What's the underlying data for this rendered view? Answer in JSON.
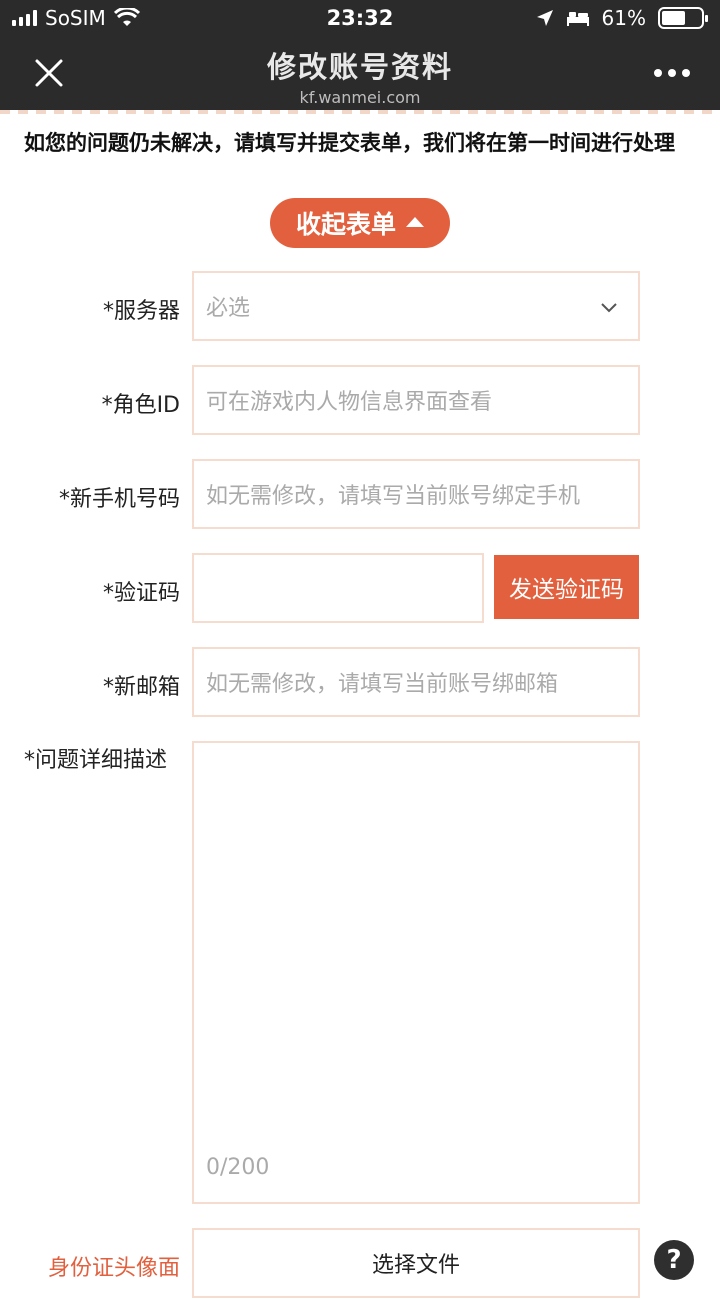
{
  "status_bar": {
    "carrier": "SoSIM",
    "time": "23:32",
    "battery_percent": "61%",
    "battery_level": 0.61
  },
  "nav": {
    "title": "修改账号资料",
    "subtitle": "kf.wanmei.com",
    "close_icon": "close-icon",
    "more_icon": "more-icon"
  },
  "notice": "如您的问题仍未解决，请填写并提交表单，我们将在第一时间进行处理",
  "collapse_button": "收起表单",
  "form": {
    "server": {
      "label": "*服务器",
      "value": "必选"
    },
    "role_id": {
      "label": "*角色ID",
      "placeholder": "可在游戏内人物信息界面查看"
    },
    "new_phone": {
      "label": "*新手机号码",
      "placeholder": "如无需修改，请填写当前账号绑定手机"
    },
    "verify_code": {
      "label": "*验证码",
      "button": "发送验证码"
    },
    "new_email": {
      "label": "*新邮箱",
      "placeholder": "如无需修改，请填写当前账号绑邮箱"
    },
    "description": {
      "label": "*问题详细描述",
      "counter": "0/200"
    },
    "id_photo": {
      "label": "身份证头像面",
      "button": "选择文件"
    }
  },
  "colors": {
    "accent": "#e2603e",
    "navbar": "#2b2b2b",
    "field_border": "#f6dccf"
  }
}
